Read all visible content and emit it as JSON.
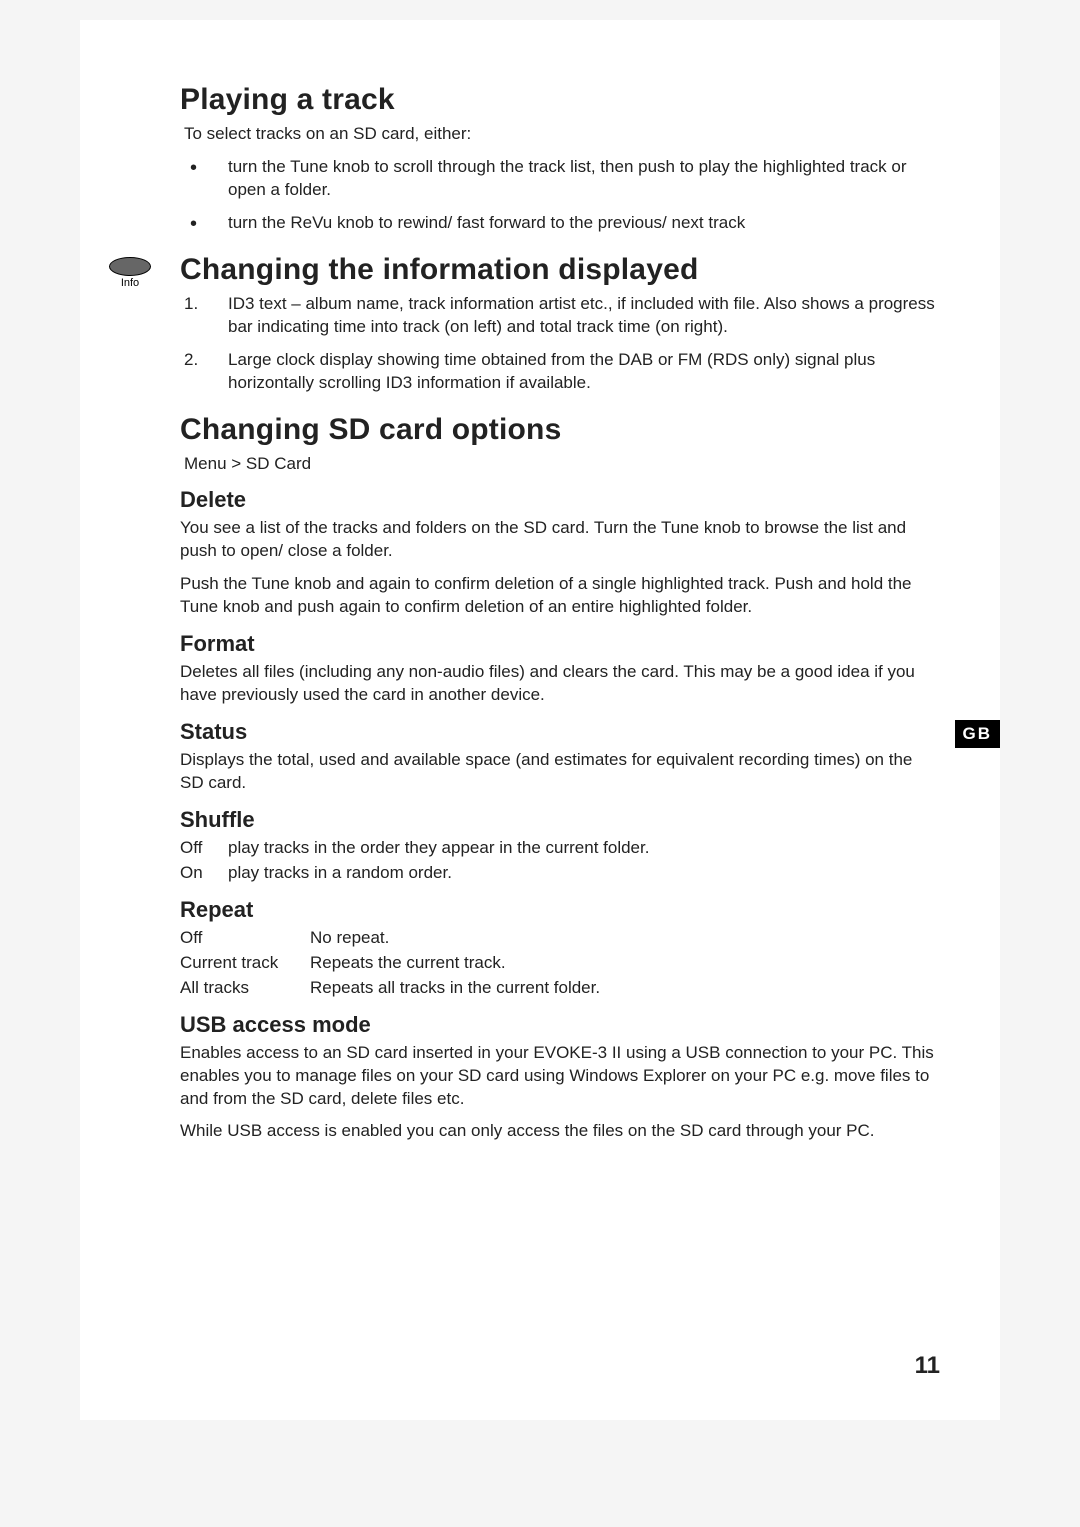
{
  "page_number": "11",
  "gb_tab": "GB",
  "info_icon_label": "Info",
  "sections": {
    "playing": {
      "title": "Playing a track",
      "intro": "To select tracks on an SD card, either:",
      "bullets": [
        "turn the Tune knob to scroll through the track list, then push to play the highlighted track or open a folder.",
        "turn the ReVu knob to rewind/ fast forward to the previous/ next track"
      ]
    },
    "changing_info": {
      "title": "Changing the information displayed",
      "items": [
        "ID3 text – album name, track information artist etc., if included with file. Also shows a progress bar indicating time into track (on left) and total track time (on right).",
        "Large clock display showing time obtained from the DAB or FM (RDS only) signal plus horizontally scrolling ID3 information if available."
      ]
    },
    "sd_options": {
      "title": "Changing SD card options",
      "menu_path": "Menu > SD Card",
      "delete": {
        "title": "Delete",
        "p1": "You see a list of the tracks and folders on the SD card. Turn the Tune knob to browse the list and push to open/ close a folder.",
        "p2": "Push the Tune knob and again to confirm deletion of a single highlighted track. Push and hold the Tune knob and push again to confirm deletion of an entire highlighted folder."
      },
      "format": {
        "title": "Format",
        "p1": "Deletes all files (including any non-audio files) and clears the card. This may be a good idea if you have previously used the card in another device."
      },
      "status": {
        "title": "Status",
        "p1": "Displays the total, used and available space (and estimates for equivalent recording times) on the SD card."
      },
      "shuffle": {
        "title": "Shuffle",
        "rows": [
          {
            "label": "Off",
            "desc": "play tracks in the order they appear in the current folder."
          },
          {
            "label": "On",
            "desc": "play tracks in a random order."
          }
        ]
      },
      "repeat": {
        "title": "Repeat",
        "rows": [
          {
            "label": "Off",
            "desc": "No repeat."
          },
          {
            "label": "Current track",
            "desc": "Repeats the current track."
          },
          {
            "label": "All tracks",
            "desc": "Repeats all tracks in the current folder."
          }
        ]
      },
      "usb": {
        "title": "USB access mode",
        "p1": "Enables access to an SD card inserted in your EVOKE-3 II using a USB connection to your PC. This enables you to manage files on your SD card using Windows Explorer on your PC e.g. move files to and from the SD card, delete files etc.",
        "p2": "While USB access is enabled you can only access the files on the SD card through your PC."
      }
    }
  }
}
